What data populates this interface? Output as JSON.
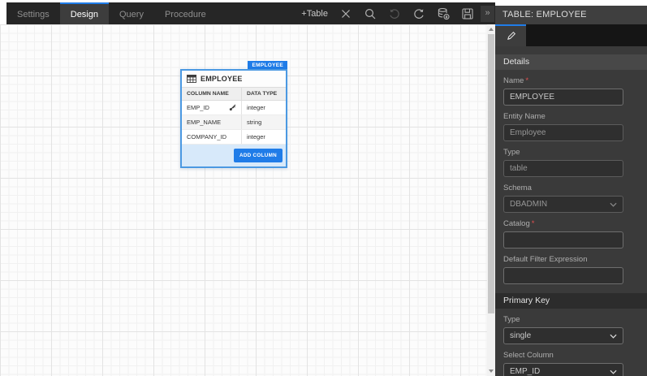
{
  "toolbar": {
    "tabs": [
      {
        "label": "Settings",
        "active": false
      },
      {
        "label": "Design",
        "active": true
      },
      {
        "label": "Query",
        "active": false
      },
      {
        "label": "Procedure",
        "active": false
      }
    ],
    "add_table_label": "+Table",
    "icon_names": [
      "close-icon",
      "search-icon",
      "undo-icon",
      "redo-icon",
      "database-export-icon",
      "save-icon"
    ],
    "collapse_glyph": "»"
  },
  "canvas": {
    "entity": {
      "badge": "EMPLOYEE",
      "title": "EMPLOYEE",
      "column_headers": [
        "COLUMN NAME",
        "DATA TYPE"
      ],
      "rows": [
        {
          "name": "EMP_ID",
          "type": "integer",
          "primary_key": true
        },
        {
          "name": "EMP_NAME",
          "type": "string",
          "primary_key": false
        },
        {
          "name": "COMPANY_ID",
          "type": "integer",
          "primary_key": false
        }
      ],
      "add_column_label": "ADD COLUMN"
    }
  },
  "side_panel": {
    "title": "TABLE: EMPLOYEE",
    "required_marker": "*",
    "details": {
      "header": "Details",
      "name_label": "Name",
      "name_value": "EMPLOYEE",
      "entity_name_label": "Entity Name",
      "entity_name_value": "Employee",
      "type_label": "Type",
      "type_value": "table",
      "schema_label": "Schema",
      "schema_value": "DBADMIN",
      "catalog_label": "Catalog",
      "catalog_value": "",
      "filter_label": "Default Filter Expression",
      "filter_value": ""
    },
    "primary_key": {
      "header": "Primary Key",
      "type_label": "Type",
      "type_value": "single",
      "column_label": "Select Column",
      "column_value": "EMP_ID"
    }
  },
  "colors": {
    "accent_blue": "#1f7ce8",
    "entity_border": "#4b99e2",
    "entity_footer_bg": "#d7e9fa",
    "toolbar_bg": "#262626",
    "panel_bg": "#3a3a3a",
    "canvas_bg": "#fcfcfc"
  }
}
